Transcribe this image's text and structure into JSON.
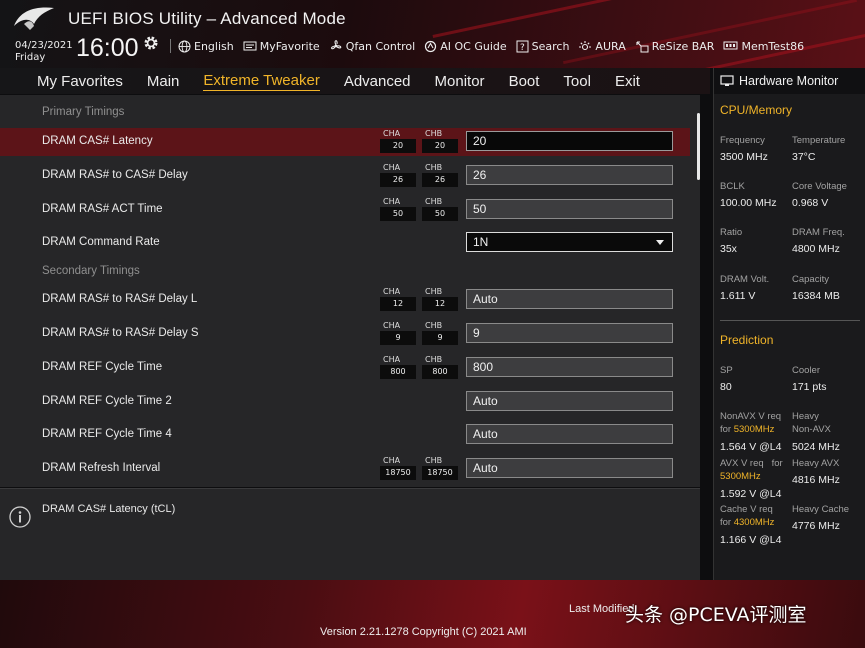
{
  "header": {
    "title": "UEFI BIOS Utility – Advanced Mode",
    "date": "04/23/2021",
    "day": "Friday",
    "time": "16:00",
    "toolbar": [
      {
        "label": "English",
        "icon": "globe-icon"
      },
      {
        "label": "MyFavorite",
        "icon": "favorite-icon"
      },
      {
        "label": "Qfan Control",
        "icon": "fan-icon"
      },
      {
        "label": "AI OC Guide",
        "icon": "ai-oc-icon"
      },
      {
        "label": "Search",
        "icon": "search-icon"
      },
      {
        "label": "AURA",
        "icon": "aura-icon"
      },
      {
        "label": "ReSize BAR",
        "icon": "resize-bar-icon"
      },
      {
        "label": "MemTest86",
        "icon": "memtest-icon"
      }
    ]
  },
  "nav": {
    "tabs": [
      "My Favorites",
      "Main",
      "Extreme Tweaker",
      "Advanced",
      "Monitor",
      "Boot",
      "Tool",
      "Exit"
    ],
    "active": "Extreme Tweaker"
  },
  "main": {
    "sections": {
      "primary": "Primary Timings",
      "secondary": "Secondary Timings"
    },
    "channel_labels": {
      "a": "CHA",
      "b": "CHB"
    },
    "rows": [
      {
        "label": "DRAM CAS# Latency",
        "cha": "20",
        "chb": "20",
        "value": "20"
      },
      {
        "label": "DRAM RAS# to CAS# Delay",
        "cha": "26",
        "chb": "26",
        "value": "26"
      },
      {
        "label": "DRAM RAS# ACT Time",
        "cha": "50",
        "chb": "50",
        "value": "50"
      },
      {
        "label": "DRAM Command Rate",
        "value": "1N"
      },
      {
        "label": "DRAM RAS# to RAS# Delay L",
        "cha": "12",
        "chb": "12",
        "value": "Auto"
      },
      {
        "label": "DRAM RAS# to RAS# Delay S",
        "cha": "9",
        "chb": "9",
        "value": "9"
      },
      {
        "label": "DRAM REF Cycle Time",
        "cha": "800",
        "chb": "800",
        "value": "800"
      },
      {
        "label": "DRAM REF Cycle Time 2",
        "value": "Auto"
      },
      {
        "label": "DRAM REF Cycle Time 4",
        "value": "Auto"
      },
      {
        "label": "DRAM Refresh Interval",
        "cha": "18750",
        "chb": "18750",
        "value": "Auto"
      }
    ]
  },
  "info": {
    "text": "DRAM CAS# Latency (tCL)"
  },
  "hw": {
    "title": "Hardware Monitor",
    "cpu_section": "CPU/Memory",
    "items": [
      {
        "label": "Frequency",
        "value": "3500 MHz"
      },
      {
        "label": "Temperature",
        "value": "37°C"
      },
      {
        "label": "BCLK",
        "value": "100.00 MHz"
      },
      {
        "label": "Core Voltage",
        "value": "0.968 V"
      },
      {
        "label": "Ratio",
        "value": "35x"
      },
      {
        "label": "DRAM Freq.",
        "value": "4800 MHz"
      },
      {
        "label": "DRAM Volt.",
        "value": "1.611 V"
      },
      {
        "label": "Capacity",
        "value": "16384 MB"
      }
    ],
    "prediction_section": "Prediction",
    "sp_label": "SP",
    "sp_value": "80",
    "cooler_label": "Cooler",
    "cooler_value": "171 pts",
    "nonavx_label": "NonAVX V req",
    "nonavx_for": "for",
    "nonavx_freq": "5300MHz",
    "nonavx_value": "1.564 V @L4",
    "heavy_nonavx_label1": "Heavy",
    "heavy_nonavx_label2": "Non-AVX",
    "heavy_nonavx_value": "5024 MHz",
    "avx_label": "AVX V req",
    "avx_for": "for",
    "avx_freq": "5300MHz",
    "avx_value": "1.592 V @L4",
    "heavy_avx_label": "Heavy AVX",
    "heavy_avx_value": "4816 MHz",
    "cache_label": "Cache V req",
    "cache_for": "for",
    "cache_freq": "4300MHz",
    "cache_value": "1.166 V @L4",
    "heavy_cache_label": "Heavy Cache",
    "heavy_cache_value": "4776 MHz"
  },
  "footer": {
    "last_modified": "Last Modified",
    "version": "Version 2.21.1278 Copyright (C) 2021 AMI",
    "watermark": "头条 @PCEVA评测室"
  },
  "colors": {
    "accent": "#f0b429",
    "selected_row": "#5c1418",
    "panel": "#262628"
  }
}
